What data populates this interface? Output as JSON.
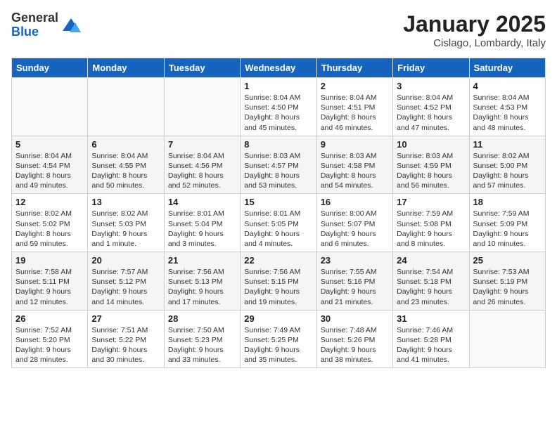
{
  "header": {
    "logo_general": "General",
    "logo_blue": "Blue",
    "month": "January 2025",
    "location": "Cislago, Lombardy, Italy"
  },
  "weekdays": [
    "Sunday",
    "Monday",
    "Tuesday",
    "Wednesday",
    "Thursday",
    "Friday",
    "Saturday"
  ],
  "weeks": [
    [
      {
        "day": "",
        "info": ""
      },
      {
        "day": "",
        "info": ""
      },
      {
        "day": "",
        "info": ""
      },
      {
        "day": "1",
        "info": "Sunrise: 8:04 AM\nSunset: 4:50 PM\nDaylight: 8 hours\nand 45 minutes."
      },
      {
        "day": "2",
        "info": "Sunrise: 8:04 AM\nSunset: 4:51 PM\nDaylight: 8 hours\nand 46 minutes."
      },
      {
        "day": "3",
        "info": "Sunrise: 8:04 AM\nSunset: 4:52 PM\nDaylight: 8 hours\nand 47 minutes."
      },
      {
        "day": "4",
        "info": "Sunrise: 8:04 AM\nSunset: 4:53 PM\nDaylight: 8 hours\nand 48 minutes."
      }
    ],
    [
      {
        "day": "5",
        "info": "Sunrise: 8:04 AM\nSunset: 4:54 PM\nDaylight: 8 hours\nand 49 minutes."
      },
      {
        "day": "6",
        "info": "Sunrise: 8:04 AM\nSunset: 4:55 PM\nDaylight: 8 hours\nand 50 minutes."
      },
      {
        "day": "7",
        "info": "Sunrise: 8:04 AM\nSunset: 4:56 PM\nDaylight: 8 hours\nand 52 minutes."
      },
      {
        "day": "8",
        "info": "Sunrise: 8:03 AM\nSunset: 4:57 PM\nDaylight: 8 hours\nand 53 minutes."
      },
      {
        "day": "9",
        "info": "Sunrise: 8:03 AM\nSunset: 4:58 PM\nDaylight: 8 hours\nand 54 minutes."
      },
      {
        "day": "10",
        "info": "Sunrise: 8:03 AM\nSunset: 4:59 PM\nDaylight: 8 hours\nand 56 minutes."
      },
      {
        "day": "11",
        "info": "Sunrise: 8:02 AM\nSunset: 5:00 PM\nDaylight: 8 hours\nand 57 minutes."
      }
    ],
    [
      {
        "day": "12",
        "info": "Sunrise: 8:02 AM\nSunset: 5:02 PM\nDaylight: 8 hours\nand 59 minutes."
      },
      {
        "day": "13",
        "info": "Sunrise: 8:02 AM\nSunset: 5:03 PM\nDaylight: 9 hours\nand 1 minute."
      },
      {
        "day": "14",
        "info": "Sunrise: 8:01 AM\nSunset: 5:04 PM\nDaylight: 9 hours\nand 3 minutes."
      },
      {
        "day": "15",
        "info": "Sunrise: 8:01 AM\nSunset: 5:05 PM\nDaylight: 9 hours\nand 4 minutes."
      },
      {
        "day": "16",
        "info": "Sunrise: 8:00 AM\nSunset: 5:07 PM\nDaylight: 9 hours\nand 6 minutes."
      },
      {
        "day": "17",
        "info": "Sunrise: 7:59 AM\nSunset: 5:08 PM\nDaylight: 9 hours\nand 8 minutes."
      },
      {
        "day": "18",
        "info": "Sunrise: 7:59 AM\nSunset: 5:09 PM\nDaylight: 9 hours\nand 10 minutes."
      }
    ],
    [
      {
        "day": "19",
        "info": "Sunrise: 7:58 AM\nSunset: 5:11 PM\nDaylight: 9 hours\nand 12 minutes."
      },
      {
        "day": "20",
        "info": "Sunrise: 7:57 AM\nSunset: 5:12 PM\nDaylight: 9 hours\nand 14 minutes."
      },
      {
        "day": "21",
        "info": "Sunrise: 7:56 AM\nSunset: 5:13 PM\nDaylight: 9 hours\nand 17 minutes."
      },
      {
        "day": "22",
        "info": "Sunrise: 7:56 AM\nSunset: 5:15 PM\nDaylight: 9 hours\nand 19 minutes."
      },
      {
        "day": "23",
        "info": "Sunrise: 7:55 AM\nSunset: 5:16 PM\nDaylight: 9 hours\nand 21 minutes."
      },
      {
        "day": "24",
        "info": "Sunrise: 7:54 AM\nSunset: 5:18 PM\nDaylight: 9 hours\nand 23 minutes."
      },
      {
        "day": "25",
        "info": "Sunrise: 7:53 AM\nSunset: 5:19 PM\nDaylight: 9 hours\nand 26 minutes."
      }
    ],
    [
      {
        "day": "26",
        "info": "Sunrise: 7:52 AM\nSunset: 5:20 PM\nDaylight: 9 hours\nand 28 minutes."
      },
      {
        "day": "27",
        "info": "Sunrise: 7:51 AM\nSunset: 5:22 PM\nDaylight: 9 hours\nand 30 minutes."
      },
      {
        "day": "28",
        "info": "Sunrise: 7:50 AM\nSunset: 5:23 PM\nDaylight: 9 hours\nand 33 minutes."
      },
      {
        "day": "29",
        "info": "Sunrise: 7:49 AM\nSunset: 5:25 PM\nDaylight: 9 hours\nand 35 minutes."
      },
      {
        "day": "30",
        "info": "Sunrise: 7:48 AM\nSunset: 5:26 PM\nDaylight: 9 hours\nand 38 minutes."
      },
      {
        "day": "31",
        "info": "Sunrise: 7:46 AM\nSunset: 5:28 PM\nDaylight: 9 hours\nand 41 minutes."
      },
      {
        "day": "",
        "info": ""
      }
    ]
  ]
}
